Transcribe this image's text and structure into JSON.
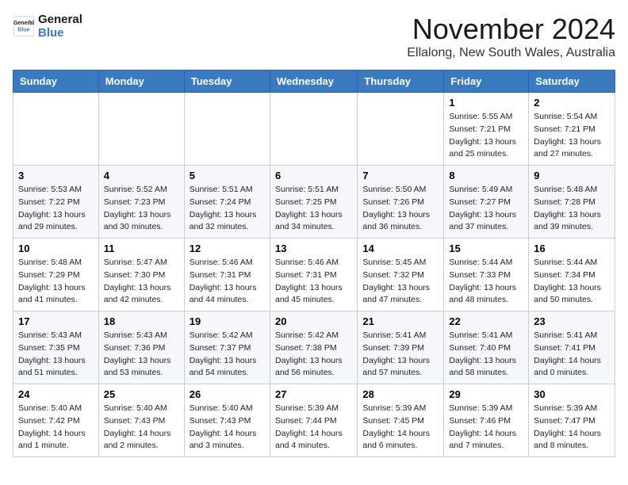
{
  "logo": {
    "line1": "General",
    "line2": "Blue"
  },
  "title": "November 2024",
  "location": "Ellalong, New South Wales, Australia",
  "weekdays": [
    "Sunday",
    "Monday",
    "Tuesday",
    "Wednesday",
    "Thursday",
    "Friday",
    "Saturday"
  ],
  "weeks": [
    [
      {
        "day": "",
        "info": ""
      },
      {
        "day": "",
        "info": ""
      },
      {
        "day": "",
        "info": ""
      },
      {
        "day": "",
        "info": ""
      },
      {
        "day": "",
        "info": ""
      },
      {
        "day": "1",
        "info": "Sunrise: 5:55 AM\nSunset: 7:21 PM\nDaylight: 13 hours\nand 25 minutes."
      },
      {
        "day": "2",
        "info": "Sunrise: 5:54 AM\nSunset: 7:21 PM\nDaylight: 13 hours\nand 27 minutes."
      }
    ],
    [
      {
        "day": "3",
        "info": "Sunrise: 5:53 AM\nSunset: 7:22 PM\nDaylight: 13 hours\nand 29 minutes."
      },
      {
        "day": "4",
        "info": "Sunrise: 5:52 AM\nSunset: 7:23 PM\nDaylight: 13 hours\nand 30 minutes."
      },
      {
        "day": "5",
        "info": "Sunrise: 5:51 AM\nSunset: 7:24 PM\nDaylight: 13 hours\nand 32 minutes."
      },
      {
        "day": "6",
        "info": "Sunrise: 5:51 AM\nSunset: 7:25 PM\nDaylight: 13 hours\nand 34 minutes."
      },
      {
        "day": "7",
        "info": "Sunrise: 5:50 AM\nSunset: 7:26 PM\nDaylight: 13 hours\nand 36 minutes."
      },
      {
        "day": "8",
        "info": "Sunrise: 5:49 AM\nSunset: 7:27 PM\nDaylight: 13 hours\nand 37 minutes."
      },
      {
        "day": "9",
        "info": "Sunrise: 5:48 AM\nSunset: 7:28 PM\nDaylight: 13 hours\nand 39 minutes."
      }
    ],
    [
      {
        "day": "10",
        "info": "Sunrise: 5:48 AM\nSunset: 7:29 PM\nDaylight: 13 hours\nand 41 minutes."
      },
      {
        "day": "11",
        "info": "Sunrise: 5:47 AM\nSunset: 7:30 PM\nDaylight: 13 hours\nand 42 minutes."
      },
      {
        "day": "12",
        "info": "Sunrise: 5:46 AM\nSunset: 7:31 PM\nDaylight: 13 hours\nand 44 minutes."
      },
      {
        "day": "13",
        "info": "Sunrise: 5:46 AM\nSunset: 7:31 PM\nDaylight: 13 hours\nand 45 minutes."
      },
      {
        "day": "14",
        "info": "Sunrise: 5:45 AM\nSunset: 7:32 PM\nDaylight: 13 hours\nand 47 minutes."
      },
      {
        "day": "15",
        "info": "Sunrise: 5:44 AM\nSunset: 7:33 PM\nDaylight: 13 hours\nand 48 minutes."
      },
      {
        "day": "16",
        "info": "Sunrise: 5:44 AM\nSunset: 7:34 PM\nDaylight: 13 hours\nand 50 minutes."
      }
    ],
    [
      {
        "day": "17",
        "info": "Sunrise: 5:43 AM\nSunset: 7:35 PM\nDaylight: 13 hours\nand 51 minutes."
      },
      {
        "day": "18",
        "info": "Sunrise: 5:43 AM\nSunset: 7:36 PM\nDaylight: 13 hours\nand 53 minutes."
      },
      {
        "day": "19",
        "info": "Sunrise: 5:42 AM\nSunset: 7:37 PM\nDaylight: 13 hours\nand 54 minutes."
      },
      {
        "day": "20",
        "info": "Sunrise: 5:42 AM\nSunset: 7:38 PM\nDaylight: 13 hours\nand 56 minutes."
      },
      {
        "day": "21",
        "info": "Sunrise: 5:41 AM\nSunset: 7:39 PM\nDaylight: 13 hours\nand 57 minutes."
      },
      {
        "day": "22",
        "info": "Sunrise: 5:41 AM\nSunset: 7:40 PM\nDaylight: 13 hours\nand 58 minutes."
      },
      {
        "day": "23",
        "info": "Sunrise: 5:41 AM\nSunset: 7:41 PM\nDaylight: 14 hours\nand 0 minutes."
      }
    ],
    [
      {
        "day": "24",
        "info": "Sunrise: 5:40 AM\nSunset: 7:42 PM\nDaylight: 14 hours\nand 1 minute."
      },
      {
        "day": "25",
        "info": "Sunrise: 5:40 AM\nSunset: 7:43 PM\nDaylight: 14 hours\nand 2 minutes."
      },
      {
        "day": "26",
        "info": "Sunrise: 5:40 AM\nSunset: 7:43 PM\nDaylight: 14 hours\nand 3 minutes."
      },
      {
        "day": "27",
        "info": "Sunrise: 5:39 AM\nSunset: 7:44 PM\nDaylight: 14 hours\nand 4 minutes."
      },
      {
        "day": "28",
        "info": "Sunrise: 5:39 AM\nSunset: 7:45 PM\nDaylight: 14 hours\nand 6 minutes."
      },
      {
        "day": "29",
        "info": "Sunrise: 5:39 AM\nSunset: 7:46 PM\nDaylight: 14 hours\nand 7 minutes."
      },
      {
        "day": "30",
        "info": "Sunrise: 5:39 AM\nSunset: 7:47 PM\nDaylight: 14 hours\nand 8 minutes."
      }
    ]
  ]
}
